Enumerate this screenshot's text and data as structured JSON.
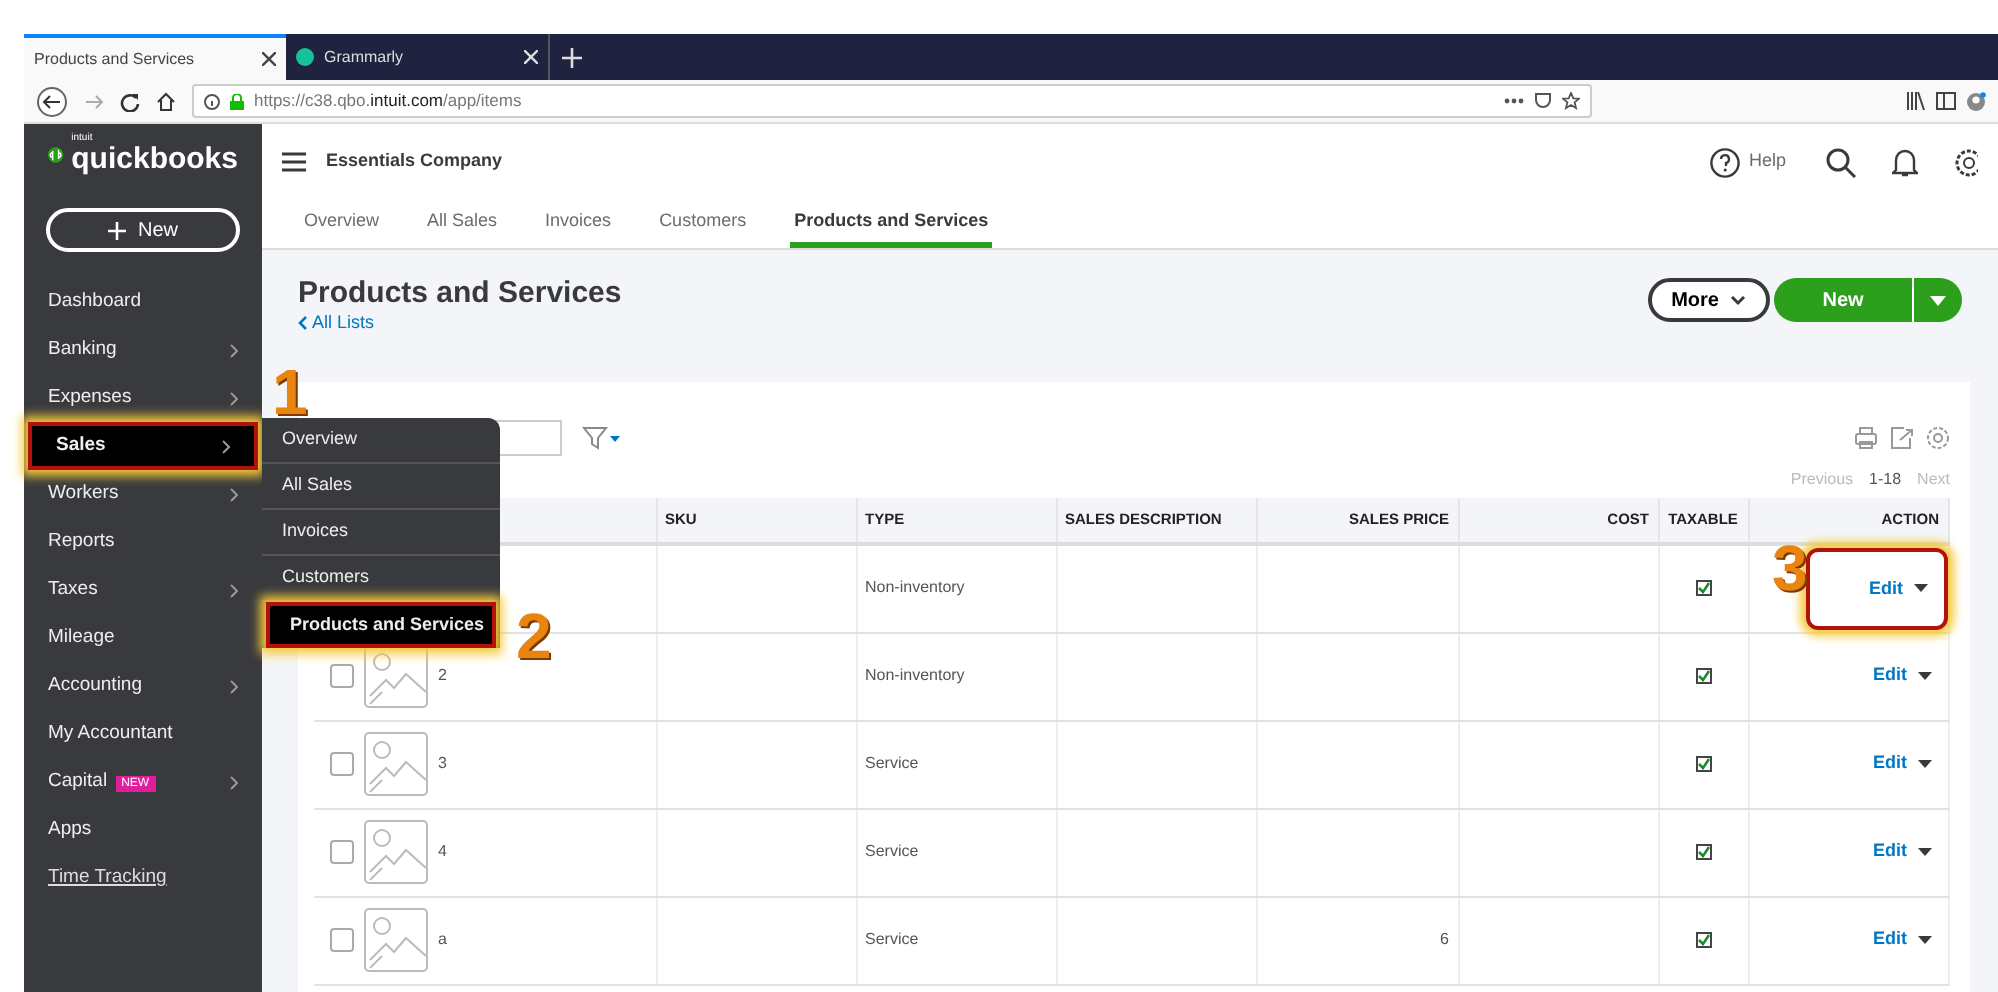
{
  "browser": {
    "tabs": [
      {
        "title": "Products and Services",
        "selected": true,
        "kind": "page"
      },
      {
        "title": "Grammarly",
        "selected": false,
        "kind": "grammarly"
      }
    ],
    "url": "https://c38.qbo.**intuit.com**/app/items"
  },
  "sidebar": {
    "logo_small": "intuit",
    "logo": "quickbooks",
    "new_button": "New",
    "items": [
      {
        "label": "Dashboard",
        "submenu": false,
        "highlighted": false,
        "kind": "item"
      },
      {
        "label": "Banking",
        "submenu": true,
        "highlighted": false,
        "kind": "item"
      },
      {
        "label": "Expenses",
        "submenu": true,
        "highlighted": false,
        "kind": "item"
      },
      {
        "label": "Sales",
        "submenu": true,
        "highlighted": true,
        "kind": "item"
      },
      {
        "label": "Workers",
        "submenu": true,
        "highlighted": false,
        "kind": "item"
      },
      {
        "label": "Reports",
        "submenu": false,
        "highlighted": false,
        "kind": "item"
      },
      {
        "label": "Taxes",
        "submenu": true,
        "highlighted": false,
        "kind": "item"
      },
      {
        "label": "Mileage",
        "submenu": false,
        "highlighted": false,
        "kind": "item"
      },
      {
        "label": "Accounting",
        "submenu": true,
        "highlighted": false,
        "kind": "item"
      },
      {
        "label": "My Accountant",
        "submenu": false,
        "highlighted": false,
        "kind": "item"
      },
      {
        "label": "Capital",
        "submenu": true,
        "highlighted": false,
        "kind": "item",
        "badge": "NEW"
      },
      {
        "label": "Apps",
        "submenu": false,
        "highlighted": false,
        "kind": "item"
      },
      {
        "label": "Time Tracking",
        "submenu": false,
        "highlighted": false,
        "kind": "link"
      }
    ]
  },
  "flyout": [
    {
      "label": "Overview",
      "highlighted": false
    },
    {
      "label": "All Sales",
      "highlighted": false
    },
    {
      "label": "Invoices",
      "highlighted": false
    },
    {
      "label": "Customers",
      "highlighted": false
    },
    {
      "label": "Products and Services",
      "highlighted": true
    }
  ],
  "header": {
    "company": "Essentials Company",
    "help": "Help"
  },
  "tabs": [
    {
      "label": "Overview",
      "selected": false
    },
    {
      "label": "All Sales",
      "selected": false
    },
    {
      "label": "Invoices",
      "selected": false
    },
    {
      "label": "Customers",
      "selected": false
    },
    {
      "label": "Products and Services",
      "selected": true
    }
  ],
  "page": {
    "title": "Products and Services",
    "back_link": "All Lists",
    "more_button": "More",
    "new_button": "New"
  },
  "pagination": {
    "previous": "Previous",
    "range": "1-18",
    "next": "Next"
  },
  "table": {
    "columns": [
      "SKU",
      "TYPE",
      "SALES DESCRIPTION",
      "SALES PRICE",
      "COST",
      "TAXABLE",
      "ACTION"
    ],
    "rows": [
      {
        "type": "Non-inventory",
        "taxable": true,
        "action": "Edit",
        "highlighted": true
      },
      {
        "name": "2",
        "checked": false,
        "type": "Non-inventory",
        "taxable": true,
        "action": "Edit",
        "highlighted": false
      },
      {
        "name": "3",
        "checked": false,
        "type": "Service",
        "taxable": true,
        "action": "Edit",
        "highlighted": false
      },
      {
        "name": "4",
        "checked": false,
        "type": "Service",
        "taxable": true,
        "action": "Edit",
        "highlighted": false
      },
      {
        "name": "a",
        "checked": false,
        "type": "Service",
        "sales_price": "6",
        "taxable": true,
        "action": "Edit",
        "highlighted": false
      }
    ]
  },
  "annotations": [
    "1",
    "2",
    "3"
  ]
}
